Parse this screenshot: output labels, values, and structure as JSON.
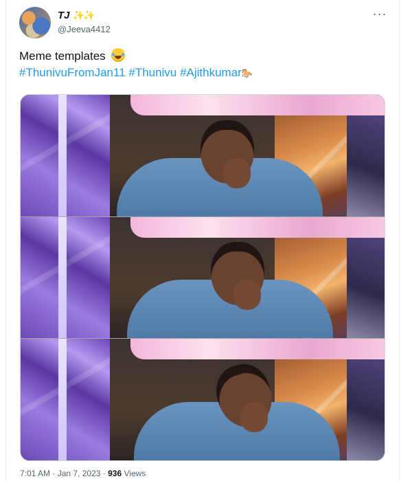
{
  "tweet": {
    "display_name": "TJ",
    "sparkles": "✨✨",
    "handle": "@Jeeva4412",
    "more_icon": "more-horizontal-icon",
    "text_line1": "Meme templates",
    "hashtags": [
      "#ThunivuFromJan11",
      "#Thunivu",
      "#Ajithkumar"
    ],
    "hashtag_icon": "🐎",
    "time": "7:01 AM",
    "date": "Jan 7, 2023",
    "separator": "·",
    "views_count": "936",
    "views_label": "Views"
  },
  "media": {
    "panels": 3,
    "description_icon": "photo"
  },
  "colors": {
    "link": "#1d9bf0",
    "text": "#0f1419",
    "muted": "#536471",
    "border": "#cfd9de"
  }
}
